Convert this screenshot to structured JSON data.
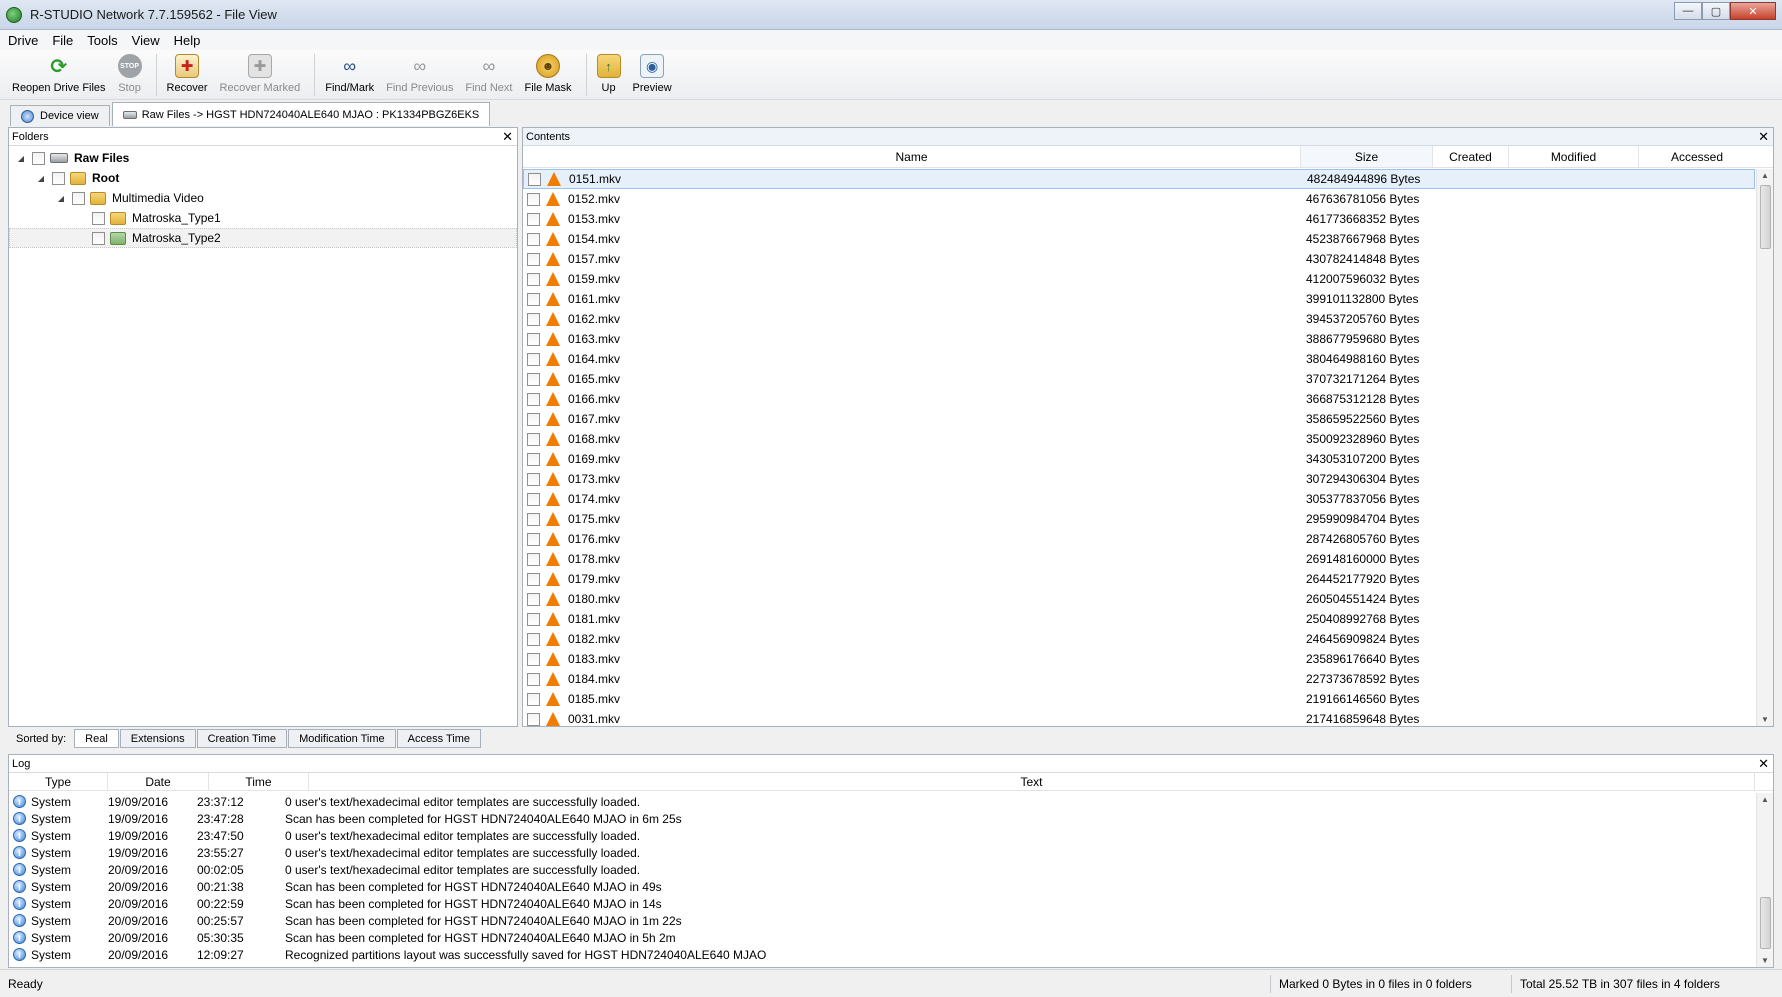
{
  "window": {
    "title": "R-STUDIO Network 7.7.159562 - File View",
    "minimize": "—",
    "maximize": "▢",
    "close": "✕"
  },
  "menu": [
    "Drive",
    "File",
    "Tools",
    "View",
    "Help"
  ],
  "toolbar": [
    {
      "label": "Reopen Drive Files",
      "icon": "reopen-icon",
      "enabled": true
    },
    {
      "label": "Stop",
      "icon": "stop-icon",
      "enabled": false
    },
    {
      "label": "Recover",
      "icon": "recover-icon",
      "enabled": true
    },
    {
      "label": "Recover Marked",
      "icon": "recover-marked-icon",
      "enabled": false
    },
    {
      "label": "Find/Mark",
      "icon": "binoculars-icon",
      "enabled": true
    },
    {
      "label": "Find Previous",
      "icon": "find-previous-icon",
      "enabled": false
    },
    {
      "label": "Find Next",
      "icon": "find-next-icon",
      "enabled": false
    },
    {
      "label": "File Mask",
      "icon": "file-mask-icon",
      "enabled": true
    },
    {
      "label": "Up",
      "icon": "folder-up-icon",
      "enabled": true
    },
    {
      "label": "Preview",
      "icon": "preview-icon",
      "enabled": true
    }
  ],
  "tabs": [
    {
      "label": "Device view",
      "active": false
    },
    {
      "label": "Raw Files -> HGST HDN724040ALE640 MJAO : PK1334PBGZ6EKS",
      "active": true
    }
  ],
  "folders": {
    "title": "Folders",
    "close": "✕",
    "tree": [
      {
        "label": "Raw Files",
        "bold": true,
        "icon": "drive-icon",
        "level": 0,
        "toggle": "◢"
      },
      {
        "label": "Root",
        "bold": true,
        "icon": "folder-icon",
        "level": 1,
        "toggle": "◢"
      },
      {
        "label": "Multimedia Video",
        "bold": false,
        "icon": "folder-icon",
        "level": 2,
        "toggle": "◢"
      },
      {
        "label": "Matroska_Type1",
        "bold": false,
        "icon": "folder-icon",
        "level": 3,
        "toggle": ""
      },
      {
        "label": "Matroska_Type2",
        "bold": false,
        "icon": "folder-green-icon",
        "level": 3,
        "toggle": "",
        "selected": true
      }
    ]
  },
  "contents": {
    "title": "Contents",
    "close": "✕",
    "columns": [
      "Name",
      "Size",
      "Created",
      "Modified",
      "Accessed"
    ],
    "sorted_column": "Size",
    "files": [
      {
        "name": "0151.mkv",
        "size": "482484944896 Bytes"
      },
      {
        "name": "0152.mkv",
        "size": "467636781056 Bytes"
      },
      {
        "name": "0153.mkv",
        "size": "461773668352 Bytes"
      },
      {
        "name": "0154.mkv",
        "size": "452387667968 Bytes"
      },
      {
        "name": "0157.mkv",
        "size": "430782414848 Bytes"
      },
      {
        "name": "0159.mkv",
        "size": "412007596032 Bytes"
      },
      {
        "name": "0161.mkv",
        "size": "399101132800 Bytes"
      },
      {
        "name": "0162.mkv",
        "size": "394537205760 Bytes"
      },
      {
        "name": "0163.mkv",
        "size": "388677959680 Bytes"
      },
      {
        "name": "0164.mkv",
        "size": "380464988160 Bytes"
      },
      {
        "name": "0165.mkv",
        "size": "370732171264 Bytes"
      },
      {
        "name": "0166.mkv",
        "size": "366875312128 Bytes"
      },
      {
        "name": "0167.mkv",
        "size": "358659522560 Bytes"
      },
      {
        "name": "0168.mkv",
        "size": "350092328960 Bytes"
      },
      {
        "name": "0169.mkv",
        "size": "343053107200 Bytes"
      },
      {
        "name": "0173.mkv",
        "size": "307294306304 Bytes"
      },
      {
        "name": "0174.mkv",
        "size": "305377837056 Bytes"
      },
      {
        "name": "0175.mkv",
        "size": "295990984704 Bytes"
      },
      {
        "name": "0176.mkv",
        "size": "287426805760 Bytes"
      },
      {
        "name": "0178.mkv",
        "size": "269148160000 Bytes"
      },
      {
        "name": "0179.mkv",
        "size": "264452177920 Bytes"
      },
      {
        "name": "0180.mkv",
        "size": "260504551424 Bytes"
      },
      {
        "name": "0181.mkv",
        "size": "250408992768 Bytes"
      },
      {
        "name": "0182.mkv",
        "size": "246456909824 Bytes"
      },
      {
        "name": "0183.mkv",
        "size": "235896176640 Bytes"
      },
      {
        "name": "0184.mkv",
        "size": "227373678592 Bytes"
      },
      {
        "name": "0185.mkv",
        "size": "219166146560 Bytes"
      },
      {
        "name": "0031.mkv",
        "size": "217416859648 Bytes"
      }
    ]
  },
  "sortbar": {
    "label": "Sorted by:",
    "tabs": [
      "Real",
      "Extensions",
      "Creation Time",
      "Modification Time",
      "Access Time"
    ],
    "active": "Real"
  },
  "log": {
    "title": "Log",
    "close": "✕",
    "columns": [
      "Type",
      "Date",
      "Time",
      "Text"
    ],
    "rows": [
      {
        "type": "System",
        "date": "19/09/2016",
        "time": "23:37:12",
        "text": "0 user's text/hexadecimal editor templates are successfully loaded."
      },
      {
        "type": "System",
        "date": "19/09/2016",
        "time": "23:47:28",
        "text": "Scan has been completed for HGST HDN724040ALE640 MJAO in 6m 25s"
      },
      {
        "type": "System",
        "date": "19/09/2016",
        "time": "23:47:50",
        "text": "0 user's text/hexadecimal editor templates are successfully loaded."
      },
      {
        "type": "System",
        "date": "19/09/2016",
        "time": "23:55:27",
        "text": "0 user's text/hexadecimal editor templates are successfully loaded."
      },
      {
        "type": "System",
        "date": "20/09/2016",
        "time": "00:02:05",
        "text": "0 user's text/hexadecimal editor templates are successfully loaded."
      },
      {
        "type": "System",
        "date": "20/09/2016",
        "time": "00:21:38",
        "text": "Scan has been completed for HGST HDN724040ALE640 MJAO in 49s"
      },
      {
        "type": "System",
        "date": "20/09/2016",
        "time": "00:22:59",
        "text": "Scan has been completed for HGST HDN724040ALE640 MJAO in 14s"
      },
      {
        "type": "System",
        "date": "20/09/2016",
        "time": "00:25:57",
        "text": "Scan has been completed for HGST HDN724040ALE640 MJAO in 1m 22s"
      },
      {
        "type": "System",
        "date": "20/09/2016",
        "time": "05:30:35",
        "text": "Scan has been completed for HGST HDN724040ALE640 MJAO in 5h 2m"
      },
      {
        "type": "System",
        "date": "20/09/2016",
        "time": "12:09:27",
        "text": "Recognized partitions layout was successfully saved for HGST HDN724040ALE640 MJAO"
      }
    ]
  },
  "status": {
    "ready": "Ready",
    "marked": "Marked 0 Bytes in 0 files in 0 folders",
    "total": "Total 25.52 TB in 307 files in 4 folders"
  }
}
